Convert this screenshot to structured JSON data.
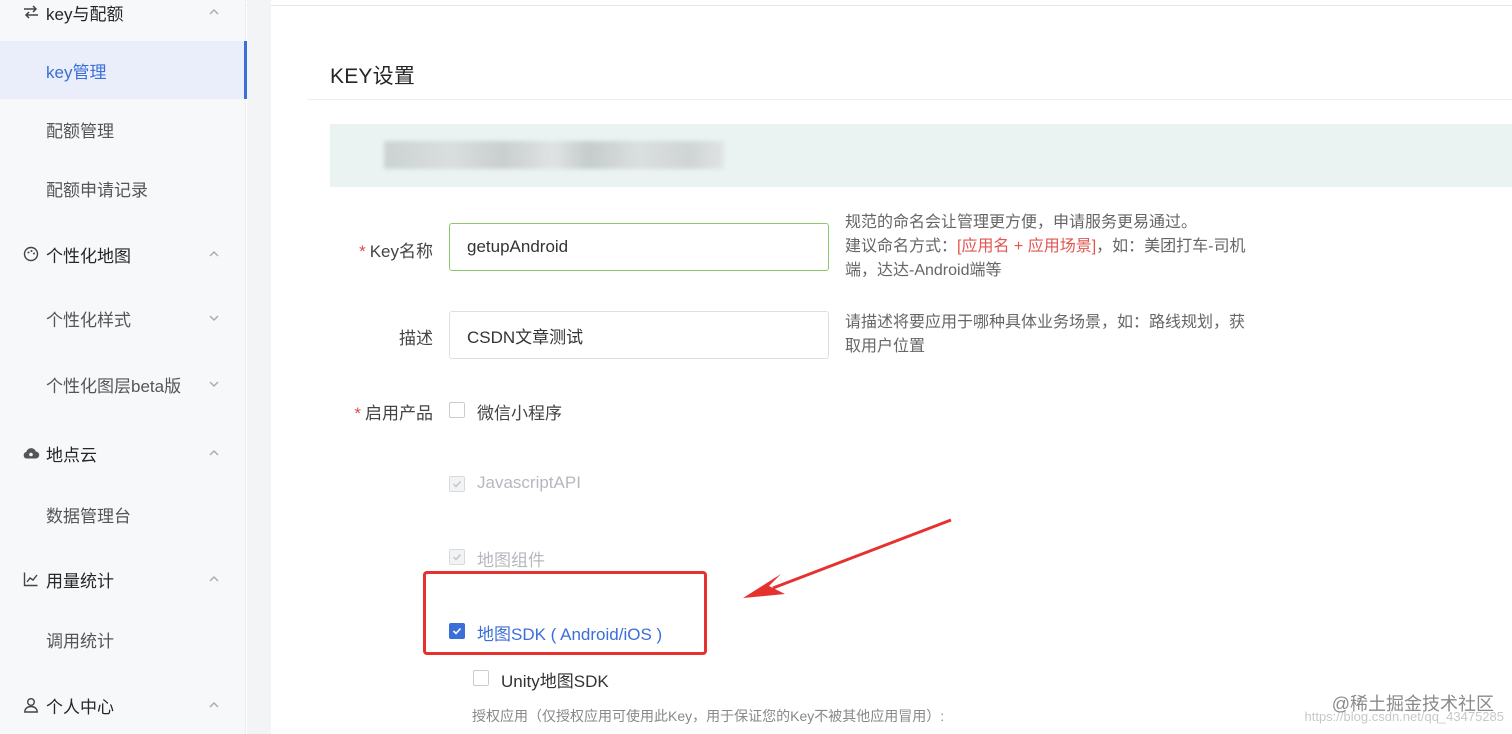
{
  "sidebar": {
    "top_group_label": "key与配额",
    "items_top": [
      {
        "label": "key管理",
        "active": true
      },
      {
        "label": "配额管理"
      },
      {
        "label": "配额申请记录"
      }
    ],
    "group_map": {
      "label": "个性化地图",
      "icon": "palette-icon"
    },
    "items_map": [
      {
        "label": "个性化样式"
      },
      {
        "label": "个性化图层beta版"
      }
    ],
    "group_cloud": {
      "label": "地点云",
      "icon": "cloud-icon"
    },
    "items_cloud": [
      {
        "label": "数据管理台"
      }
    ],
    "group_stats": {
      "label": "用量统计",
      "icon": "chart-line-icon"
    },
    "items_stats": [
      {
        "label": "调用统计"
      }
    ],
    "group_user": {
      "label": "个人中心",
      "icon": "user-icon"
    }
  },
  "main": {
    "title": "KEY设置",
    "form": {
      "required_mark": "*",
      "key_name_label": "Key名称",
      "key_name_value": "getupAndroid",
      "key_name_hint_1": "规范的命名会让管理更方便，申请服务更易通过。",
      "key_name_hint_2a": "建议命名方式：",
      "key_name_hint_2b": "[应用名 + 应用场景]",
      "key_name_hint_2c": "，如：美团打车-司机",
      "key_name_hint_3": "端，达达-Android端等",
      "desc_label": "描述",
      "desc_value": "CSDN文章测试",
      "desc_hint_1": "请描述将要应用于哪种具体业务场景，如：路线规划，获",
      "desc_hint_2": "取用户位置",
      "products_label": "启用产品",
      "products": [
        {
          "label": "微信小程序",
          "checked": false,
          "disabled": false
        },
        {
          "label": "JavascriptAPI",
          "checked": true,
          "disabled": true
        },
        {
          "label": "地图组件",
          "checked": true,
          "disabled": true
        },
        {
          "label": "地图SDK ( Android/iOS )",
          "checked": true,
          "disabled": false
        },
        {
          "label": "Unity地图SDK",
          "checked": false,
          "disabled": false
        }
      ],
      "auth_note": "授权应用（仅授权应用可使用此Key，用于保证您的Key不被其他应用冒用）:"
    }
  },
  "watermark": "@稀土掘金技术社区",
  "watermark_url": "https://blog.csdn.net/qq_43475285",
  "colors": {
    "accent": "#3c6ed8",
    "highlight": "#e5322e",
    "required": "#e24a4a"
  }
}
